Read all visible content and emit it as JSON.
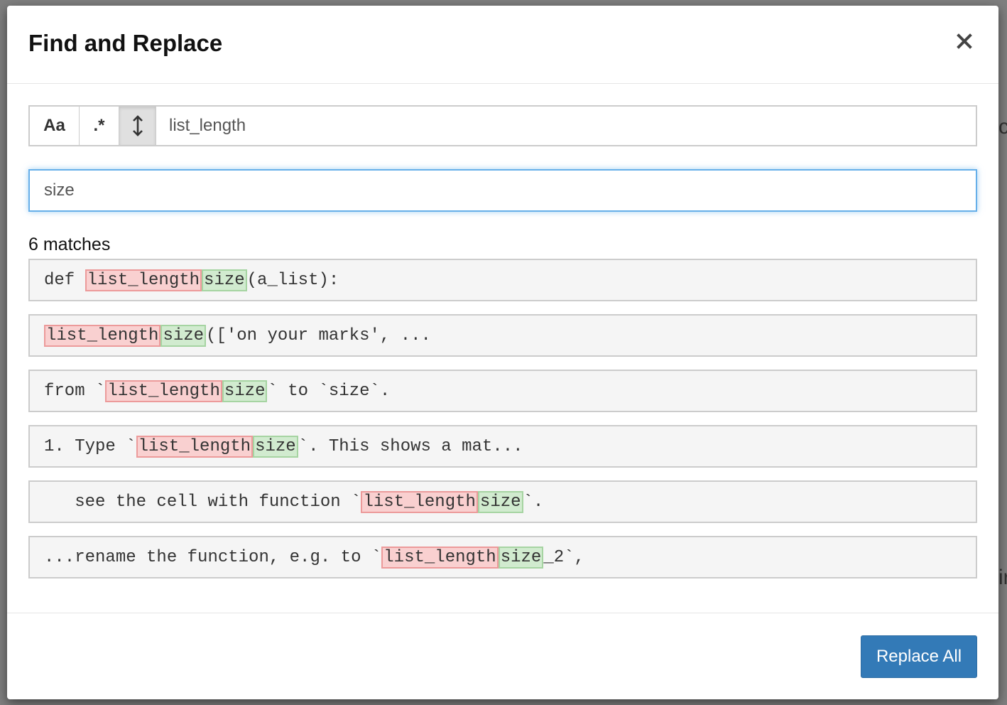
{
  "backdrop": {
    "right_text_1": "c",
    "right_text_2": "ir"
  },
  "dialog": {
    "title": "Find and Replace",
    "close_glyph": "×",
    "find": {
      "case_label": "Aa",
      "regex_label": ".*",
      "multiline_icon": "vertical-arrows-icon",
      "value": "list_length"
    },
    "replace": {
      "value": "size"
    },
    "match_count": "6 matches",
    "matches": [
      {
        "before": "def ",
        "old": "list_length",
        "new": "size",
        "after": "(a_list):"
      },
      {
        "before": "",
        "old": "list_length",
        "new": "size",
        "after": "(['on your marks', ..."
      },
      {
        "before": "from `",
        "old": "list_length",
        "new": "size",
        "after": "` to `size`."
      },
      {
        "before": "1. Type `",
        "old": "list_length",
        "new": "size",
        "after": "`. This shows a mat..."
      },
      {
        "before": "   see the cell with function `",
        "old": "list_length",
        "new": "size",
        "after": "`."
      },
      {
        "before": "...rename the function, e.g. to `",
        "old": "list_length",
        "new": "size",
        "after": "_2`,"
      }
    ],
    "replace_all_label": "Replace All"
  },
  "colors": {
    "primary": "#337ab7",
    "removed_bg": "#f9d0d0",
    "added_bg": "#d1ebcf",
    "focus_border": "#66afe9"
  }
}
